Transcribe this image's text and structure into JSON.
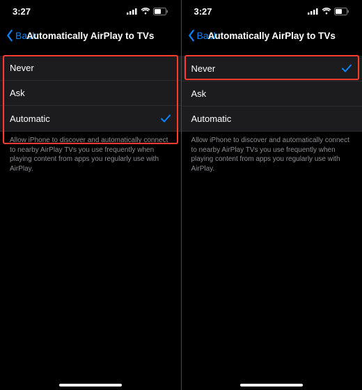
{
  "statusbar": {
    "time": "3:27"
  },
  "nav": {
    "back": "Back",
    "title": "Automatically AirPlay to TVs"
  },
  "options": {
    "never": "Never",
    "ask": "Ask",
    "automatic": "Automatic"
  },
  "footer": "Allow iPhone to discover and automatically connect to nearby AirPlay TVs you use frequently when playing content from apps you regularly use with AirPlay.",
  "screens": [
    {
      "selected": "automatic",
      "highlight": "group"
    },
    {
      "selected": "never",
      "highlight": "never"
    }
  ],
  "colors": {
    "accent": "#0a84ff",
    "highlight": "#ff3b30"
  }
}
